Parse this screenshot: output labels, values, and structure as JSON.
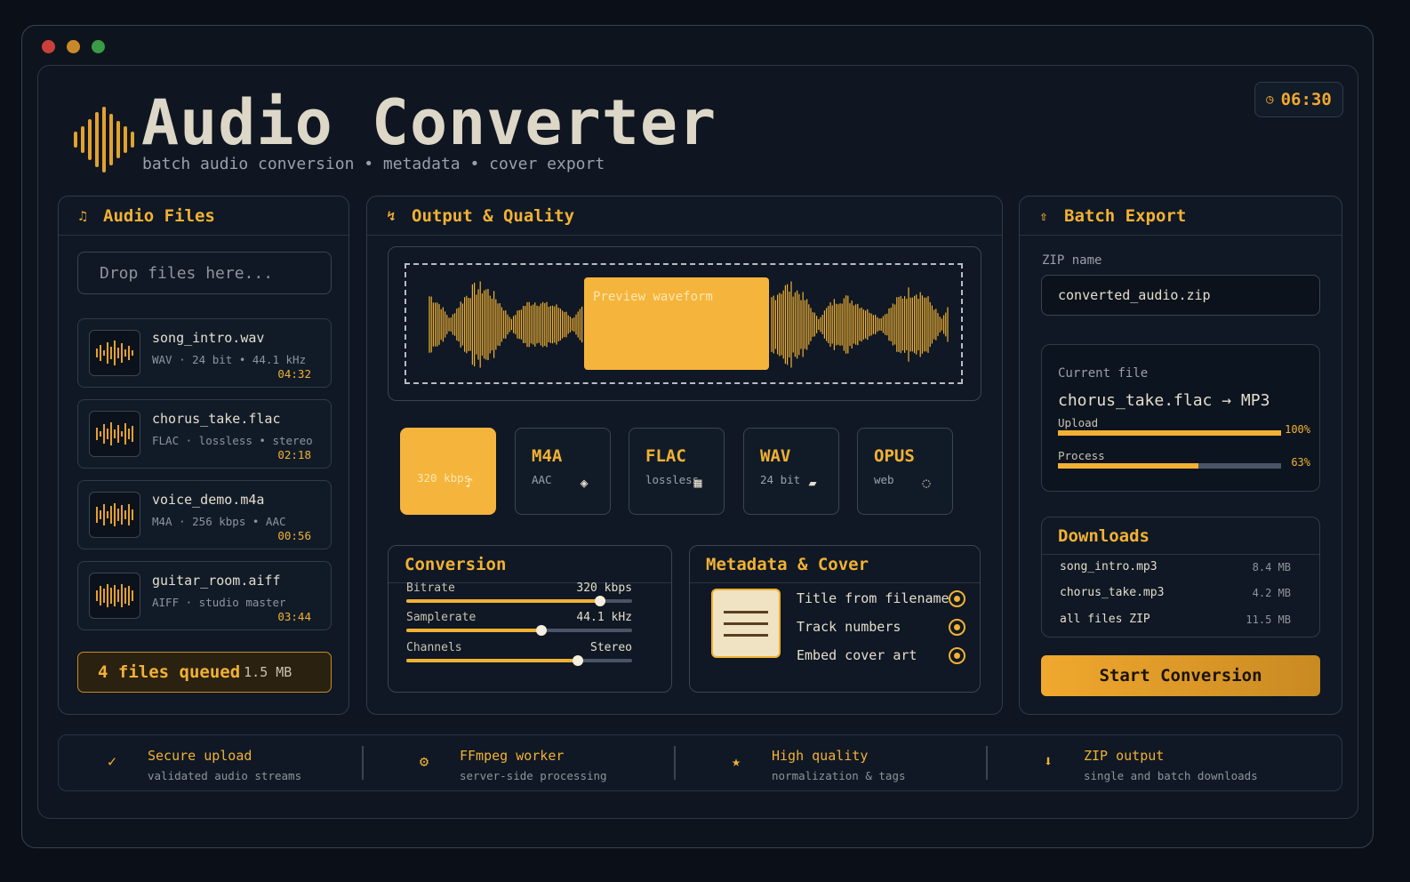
{
  "app": {
    "title": "Audio Converter",
    "subtitle": "batch audio conversion • metadata • cover export",
    "clock": "06:30"
  },
  "files_panel": {
    "title": "Audio Files",
    "icon": "music-note-icon",
    "dropzone_placeholder": "Drop files here...",
    "files": [
      {
        "name": "song_intro.wav",
        "meta": "WAV  ·  24 bit • 44.1 kHz",
        "duration": "04:32"
      },
      {
        "name": "chorus_take.flac",
        "meta": "FLAC  ·  lossless • stereo",
        "duration": "02:18"
      },
      {
        "name": "voice_demo.m4a",
        "meta": "M4A  ·  256 kbps • AAC",
        "duration": "00:56"
      },
      {
        "name": "guitar_room.aiff",
        "meta": "AIFF  ·  studio master",
        "duration": "03:44"
      }
    ],
    "queue_label": "4 files queued",
    "queue_size": "1.5 MB"
  },
  "output_panel": {
    "title": "Output & Quality",
    "preview_label": "Preview waveform",
    "formats": [
      {
        "name": "",
        "sub": "320 kbps",
        "icon": "♪",
        "active": true
      },
      {
        "name": "M4A",
        "sub": "AAC",
        "icon": "◈",
        "active": false
      },
      {
        "name": "FLAC",
        "sub": "lossless",
        "icon": "▦",
        "active": false
      },
      {
        "name": "WAV",
        "sub": "24 bit",
        "icon": "▰",
        "active": false
      },
      {
        "name": "OPUS",
        "sub": "web",
        "icon": "◌",
        "active": false
      }
    ],
    "conversion": {
      "title": "Conversion",
      "sliders": [
        {
          "label": "Bitrate",
          "value": "320 kbps",
          "level": 0.86
        },
        {
          "label": "Samplerate",
          "value": "44.1 kHz",
          "level": 0.6
        },
        {
          "label": "Channels",
          "value": "Stereo",
          "level": 0.76
        }
      ]
    },
    "metadata": {
      "title": "Metadata & Cover",
      "options": [
        {
          "label": "Title from filename",
          "checked": true
        },
        {
          "label": "Track numbers",
          "checked": true
        },
        {
          "label": "Embed cover art",
          "checked": true
        }
      ]
    }
  },
  "export_panel": {
    "title": "Batch Export",
    "zip_label": "ZIP name",
    "zip_value": "converted_audio.zip",
    "current_label": "Current file",
    "current_file": "chorus_take.flac → MP3",
    "progress": [
      {
        "label": "Upload",
        "percent": "100%",
        "level": 1.0
      },
      {
        "label": "Process",
        "percent": "63%",
        "level": 0.63
      }
    ],
    "downloads_title": "Downloads",
    "downloads": [
      {
        "name": "song_intro.mp3",
        "size": "8.4 MB"
      },
      {
        "name": "chorus_take.mp3",
        "size": "4.2 MB"
      },
      {
        "name": "all files ZIP",
        "size": "11.5 MB"
      }
    ],
    "start_label": "Start Conversion"
  },
  "features": [
    {
      "icon": "✓",
      "title": "Secure upload",
      "sub": "validated audio streams"
    },
    {
      "icon": "⚙",
      "title": "FFmpeg worker",
      "sub": "server-side processing"
    },
    {
      "icon": "★",
      "title": "High quality",
      "sub": "normalization & tags"
    },
    {
      "icon": "⬇",
      "title": "ZIP output",
      "sub": "single and batch downloads"
    }
  ],
  "colors": {
    "accent": "#f2b134",
    "background": "#0e141d"
  }
}
